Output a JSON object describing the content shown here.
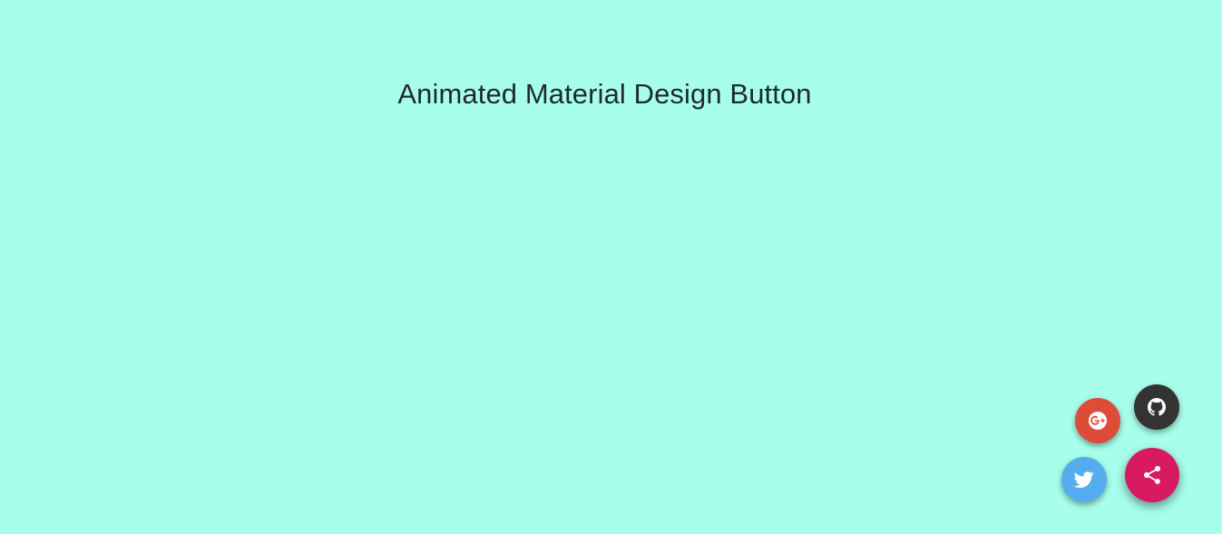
{
  "page": {
    "title": "Animated Material Design Button",
    "background_color": "#a7ffeb"
  },
  "fab_menu": {
    "main": {
      "icon": "share-icon",
      "color": "#d81b60"
    },
    "items": [
      {
        "name": "github",
        "icon": "github-icon",
        "color": "#333333"
      },
      {
        "name": "google-plus",
        "icon": "google-plus-icon",
        "color": "#dd4b39"
      },
      {
        "name": "twitter",
        "icon": "twitter-icon",
        "color": "#55acee"
      }
    ]
  }
}
